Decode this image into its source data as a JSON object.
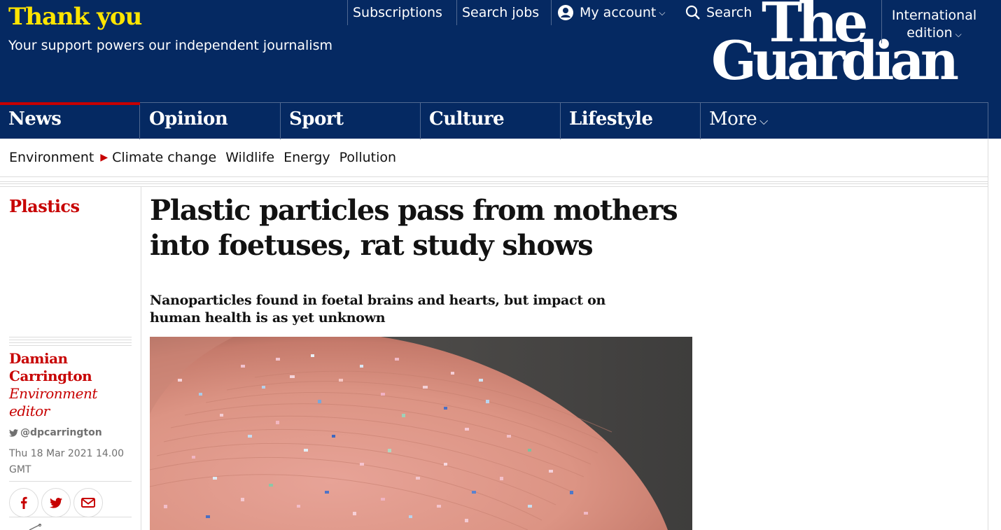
{
  "header": {
    "thankyou": "Thank you",
    "support": "Your support powers our independent journalism",
    "links": {
      "subscriptions": "Subscriptions",
      "search_jobs": "Search jobs",
      "my_account": "My account",
      "search": "Search"
    },
    "logo": {
      "line1": "The",
      "line2": "Guardian"
    },
    "edition": {
      "line1": "International",
      "line2": "edition"
    }
  },
  "pillars": {
    "news": "News",
    "opinion": "Opinion",
    "sport": "Sport",
    "culture": "Culture",
    "lifestyle": "Lifestyle",
    "more": "More"
  },
  "subnav": {
    "environment": "Environment",
    "climate": "Climate change",
    "wildlife": "Wildlife",
    "energy": "Energy",
    "pollution": "Pollution"
  },
  "article": {
    "section": "Plastics",
    "headline": "Plastic particles pass from mothers into foetuses, rat study shows",
    "standfirst": "Nanoparticles found in foetal brains and hearts, but impact on human health is as yet unknown",
    "author_first": "Damian",
    "author_last": "Carrington",
    "role_line1": "Environment",
    "role_line2": "editor",
    "twitter": "@dpcarrington",
    "date_line1": "Thu 18 Mar 2021 14.00",
    "date_line2": "GMT"
  },
  "colors": {
    "brand_blue": "#052962",
    "accent_yellow": "#ffe500",
    "news_red": "#c70000"
  },
  "icons": [
    "account-icon",
    "search-icon",
    "chevron-down-icon",
    "twitter-icon",
    "facebook-icon",
    "email-icon",
    "comment-icon"
  ]
}
